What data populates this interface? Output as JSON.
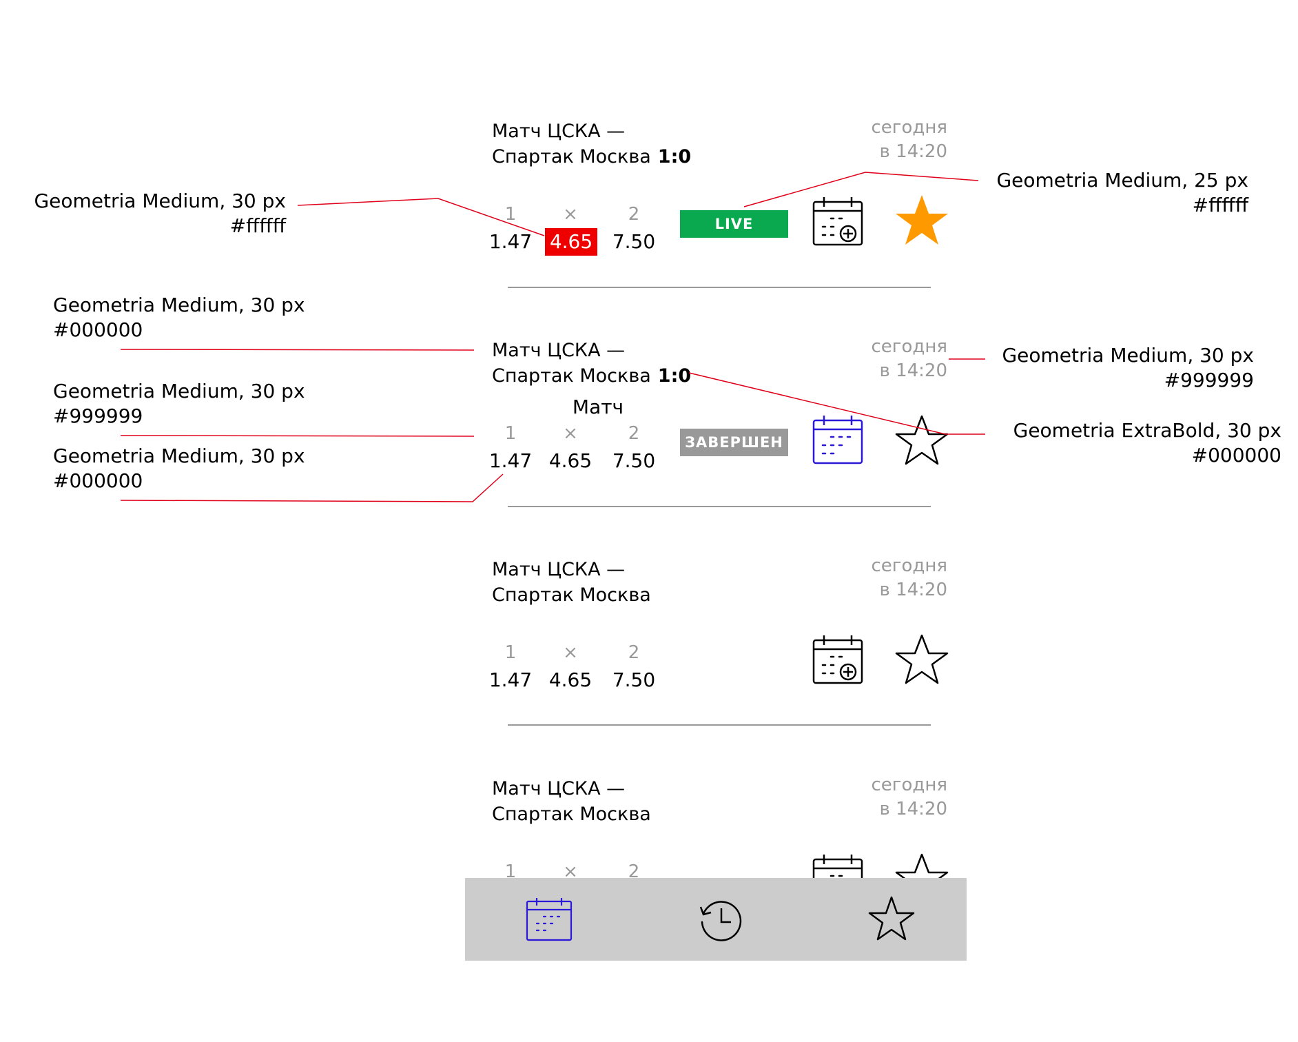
{
  "matches": [
    {
      "title_line1": "Матч ЦСКА —",
      "title_line2": "Спартак Москва",
      "score": "1:0",
      "date_line1": "сегодня",
      "date_line2": "в 14:20",
      "odds_labels": [
        "1",
        "×",
        "2"
      ],
      "odds_values": [
        "1.47",
        "4.65",
        "7.50"
      ],
      "status": "LIVE",
      "calendar_icon": "calendar-add-icon",
      "favorite_icon": "star-filled-icon"
    },
    {
      "title_line1": "Матч ЦСКА —",
      "title_line2": "Спартак Москва",
      "score": "1:0",
      "sub_label": "Матч",
      "date_line1": "сегодня",
      "date_line2": "в 14:20",
      "odds_labels": [
        "1",
        "×",
        "2"
      ],
      "odds_values": [
        "1.47",
        "4.65",
        "7.50"
      ],
      "status": "ЗАВЕРШЕН",
      "calendar_icon": "calendar-added-icon",
      "favorite_icon": "star-outline-icon"
    },
    {
      "title_line1": "Матч ЦСКА —",
      "title_line2": "Спартак Москва",
      "date_line1": "сегодня",
      "date_line2": "в 14:20",
      "odds_labels": [
        "1",
        "×",
        "2"
      ],
      "odds_values": [
        "1.47",
        "4.65",
        "7.50"
      ],
      "calendar_icon": "calendar-add-icon",
      "favorite_icon": "star-outline-icon"
    },
    {
      "title_line1": "Матч ЦСКА —",
      "title_line2": "Спартак Москва",
      "date_line1": "сегодня",
      "date_line2": "в 14:20",
      "odds_labels": [
        "1",
        "×",
        "2"
      ],
      "calendar_icon": "calendar-add-icon",
      "favorite_icon": "star-outline-icon"
    }
  ],
  "annotations": {
    "highlight_odd": {
      "line1": "Geometria Medium, 30 px",
      "line2": "#ffffff"
    },
    "live_badge": {
      "line1": "Geometria Medium, 25 px",
      "line2": "#ffffff"
    },
    "title_text": {
      "line1": "Geometria Medium, 30 px",
      "line2": "#000000"
    },
    "odds_label": {
      "line1": "Geometria Medium, 30 px",
      "line2": "#999999"
    },
    "odds_value": {
      "line1": "Geometria Medium, 30 px",
      "line2": "#000000"
    },
    "date_text": {
      "line1": "Geometria Medium, 30 px",
      "line2": "#999999"
    },
    "score_text": {
      "line1": "Geometria ExtraBold, 30 px",
      "line2": "#000000"
    }
  },
  "tabbar": {
    "tabs": [
      {
        "icon": "calendar-icon",
        "active": true
      },
      {
        "icon": "history-icon",
        "active": false
      },
      {
        "icon": "star-outline-icon",
        "active": false
      }
    ]
  },
  "colors": {
    "live": "#0aa84f",
    "highlight": "#ee0000",
    "finished": "#999999",
    "star_active": "#ff9900",
    "accent": "#2a1ad8",
    "annotation_line": "#e0001a",
    "tabbar_bg": "#cccccc"
  }
}
